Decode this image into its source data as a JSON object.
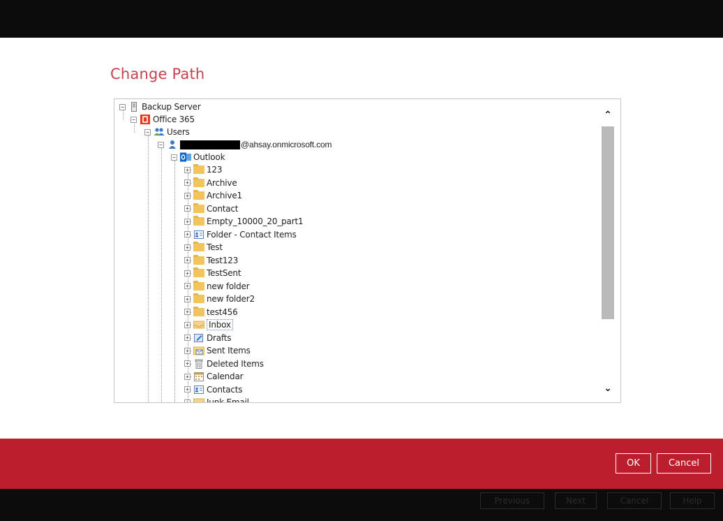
{
  "dialog": {
    "title": "Change Path"
  },
  "tree": {
    "root": {
      "label": "Backup Server",
      "icon": "server-icon"
    },
    "office365": {
      "label": "Office 365",
      "icon": "office365-icon"
    },
    "users": {
      "label": "Users",
      "icon": "users-icon"
    },
    "user": {
      "label": "@ahsay.onmicrosoft.com",
      "icon": "user-icon",
      "redacted": true
    },
    "outlook": {
      "label": "Outlook",
      "icon": "outlook-icon"
    },
    "folders": [
      {
        "label": "123",
        "icon": "folder-icon"
      },
      {
        "label": "Archive",
        "icon": "folder-icon"
      },
      {
        "label": "Archive1",
        "icon": "folder-icon"
      },
      {
        "label": "Contact",
        "icon": "folder-icon"
      },
      {
        "label": "Empty_10000_20_part1",
        "icon": "folder-icon"
      },
      {
        "label": "Folder - Contact Items",
        "icon": "contact-card-icon"
      },
      {
        "label": "Test",
        "icon": "folder-icon"
      },
      {
        "label": "Test123",
        "icon": "folder-icon"
      },
      {
        "label": "TestSent",
        "icon": "folder-icon"
      },
      {
        "label": "new folder",
        "icon": "folder-icon"
      },
      {
        "label": "new folder2",
        "icon": "folder-icon"
      },
      {
        "label": "test456",
        "icon": "folder-icon"
      },
      {
        "label": "Inbox",
        "icon": "inbox-icon",
        "selected": true
      },
      {
        "label": "Drafts",
        "icon": "drafts-icon"
      },
      {
        "label": "Sent Items",
        "icon": "sent-items-icon"
      },
      {
        "label": "Deleted Items",
        "icon": "trash-icon"
      },
      {
        "label": "Calendar",
        "icon": "calendar-icon"
      },
      {
        "label": "Contacts",
        "icon": "contacts-icon"
      },
      {
        "label": "Junk Email",
        "icon": "junk-icon"
      }
    ]
  },
  "buttons": {
    "ok": "OK",
    "cancel": "Cancel"
  },
  "background_buttons": {
    "previous": "Previous",
    "next": "Next",
    "cancel": "Cancel",
    "help": "Help"
  },
  "colors": {
    "title": "#c8414f",
    "footer": "#bb1e2c",
    "topbar": "#0c0c0c"
  }
}
